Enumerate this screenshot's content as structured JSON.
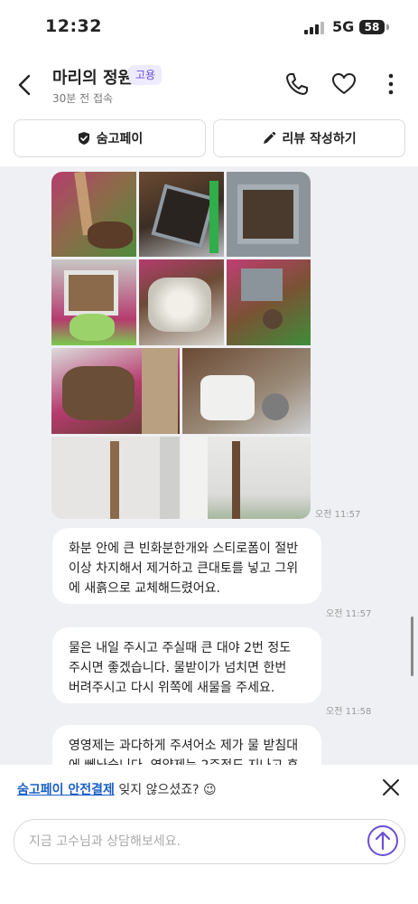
{
  "status_bar": {
    "time": "12:32",
    "network": "5G",
    "battery": "58"
  },
  "header": {
    "title": "마리의 정원",
    "badge": "고용",
    "subtitle": "30분 전 접속"
  },
  "actions": {
    "pay_label": "숨고페이",
    "review_label": "리뷰 작성하기"
  },
  "messages": [
    {
      "type": "photos",
      "time": "오전 11:57"
    },
    {
      "type": "text",
      "lines": [
        "화분 안에 큰 빈화분한개와 스티로폼이 절반",
        "이상 차지해서 제거하고 큰대토를 넣고 그위",
        "에 새흙으로 교체해드렸어요."
      ],
      "time": "오전 11:57"
    },
    {
      "type": "text",
      "lines": [
        "물은 내일 주시고 주실때 큰 대야 2번 정도",
        "주시면 좋겠습니다. 물받이가 넘치면 한번",
        "버려주시고 다시 위쪽에 새물을 주세요."
      ],
      "time": "오전 11:58"
    },
    {
      "type": "text",
      "lines": [
        "영영제는 과다하게 주셔어소 제가 물 받침대",
        "에 뻬놔습니다. 영양제는 2주정도 지나고 후"
      ],
      "time": ""
    }
  ],
  "reminder": {
    "link": "숨고페이 안전결제",
    "text": " 잊지 않으셨죠? 😉"
  },
  "composer": {
    "placeholder": "지금 고수님과 상담해보세요."
  },
  "colors": {
    "accent": "#6a4fd8",
    "link": "#1b5fc6",
    "chat_bg": "#eff0f3"
  }
}
